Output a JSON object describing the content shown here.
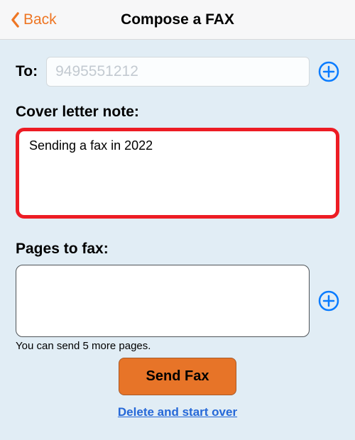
{
  "header": {
    "back_label": "Back",
    "title": "Compose a FAX"
  },
  "to": {
    "label": "To:",
    "placeholder": "9495551212",
    "value": ""
  },
  "cover": {
    "label": "Cover letter note:",
    "value": "Sending a fax in 2022"
  },
  "pages": {
    "label": "Pages to fax:",
    "hint": "You can send 5 more pages."
  },
  "actions": {
    "send_label": "Send Fax",
    "delete_label": "Delete and start over"
  },
  "icons": {
    "back_chevron": "chevron-left",
    "add_recipient": "plus-circle",
    "add_page": "plus-circle"
  }
}
